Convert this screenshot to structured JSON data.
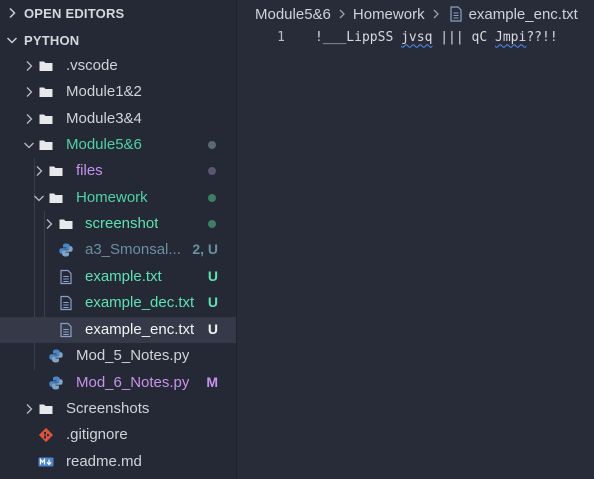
{
  "sidebar": {
    "open_editors_title": "OPEN EDITORS",
    "python_title": "PYTHON",
    "items": [
      {
        "label": ".vscode",
        "type": "folder",
        "expanded": false,
        "color": "#d0d3da",
        "badge": ""
      },
      {
        "label": "Module1&2",
        "type": "folder",
        "expanded": false,
        "color": "#d0d3da",
        "badge": ""
      },
      {
        "label": "Module3&4",
        "type": "folder",
        "expanded": false,
        "color": "#d0d3da",
        "badge": ""
      },
      {
        "label": "Module5&6",
        "type": "folder",
        "expanded": true,
        "color": "#4fd1a7",
        "badge": "",
        "dot_color": "#5a6a70"
      },
      {
        "label": "files",
        "type": "folder",
        "expanded": false,
        "color": "#c792ea",
        "badge": "",
        "dot_color": "#5a5570"
      },
      {
        "label": "Homework",
        "type": "folder",
        "expanded": true,
        "color": "#4fd1a7",
        "badge": "",
        "dot_color": "#3e7d66"
      },
      {
        "label": "screenshot",
        "type": "folder",
        "expanded": false,
        "color": "#5ee2b2",
        "badge": "",
        "dot_color": "#3e7d66"
      },
      {
        "label": "a3_Smonsal...",
        "type": "python",
        "color": "#6a8fa0",
        "badge": "2, U",
        "badge_color": "#6a8fa0"
      },
      {
        "label": "example.txt",
        "type": "text",
        "color": "#5ee2b2",
        "badge": "U",
        "badge_color": "#5ee2b2"
      },
      {
        "label": "example_dec.txt",
        "type": "text",
        "color": "#5ee2b2",
        "badge": "U",
        "badge_color": "#5ee2b2"
      },
      {
        "label": "example_enc.txt",
        "type": "text",
        "color": "#f2f3f5",
        "badge": "U",
        "badge_color": "#f2f3f5",
        "selected": true
      },
      {
        "label": "Mod_5_Notes.py",
        "type": "python",
        "color": "#d0d3da",
        "badge": ""
      },
      {
        "label": "Mod_6_Notes.py",
        "type": "python",
        "color": "#c792ea",
        "badge": "M",
        "badge_color": "#c792ea"
      },
      {
        "label": "Screenshots",
        "type": "folder",
        "expanded": false,
        "color": "#d0d3da",
        "badge": ""
      },
      {
        "label": ".gitignore",
        "type": "git",
        "color": "#d0d3da",
        "badge": ""
      },
      {
        "label": "readme.md",
        "type": "markdown",
        "color": "#d0d3da",
        "badge": ""
      }
    ]
  },
  "editor": {
    "breadcrumb": [
      "Module5&6",
      "Homework",
      "example_enc.txt"
    ],
    "line_number": "1",
    "code_parts": [
      "!___LippSS ",
      "jvsq",
      " ||| qC ",
      "Jmpi",
      "??!!"
    ]
  },
  "colors": {
    "accent": "#4fd1a7",
    "modified": "#c792ea",
    "untracked": "#5ee2b2",
    "squiggle": "#4f8ef7"
  }
}
